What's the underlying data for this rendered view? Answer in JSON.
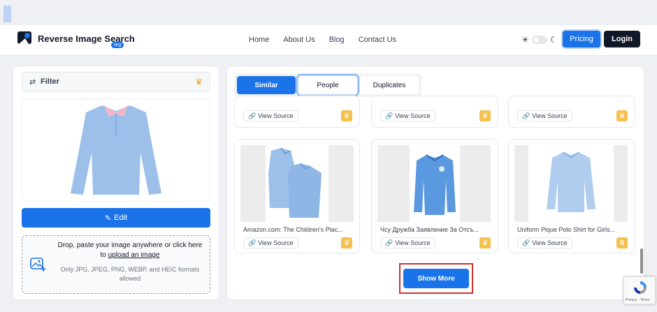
{
  "header": {
    "brand": "Reverse Image Search",
    "brand_badge": "org",
    "nav": [
      "Home",
      "About Us",
      "Blog",
      "Contact Us"
    ],
    "pricing": "Pricing",
    "login": "Login"
  },
  "sidebar": {
    "filter_label": "Filter",
    "edit_label": "Edit",
    "dropzone": {
      "line1": "Drop, paste your image anywhere or click here",
      "line2_prefix": "to ",
      "line2_link": "upload an image",
      "line3": "Only JPG, JPEG, PNG, WEBP, and HEIC formats allowed"
    }
  },
  "tabs": [
    {
      "label": "Similar",
      "state": "active"
    },
    {
      "label": "People",
      "state": "focused"
    },
    {
      "label": "Duplicates",
      "state": "normal"
    }
  ],
  "results_top": [
    {
      "source_label": "View Source"
    },
    {
      "source_label": "View Source"
    },
    {
      "source_label": "View Source"
    }
  ],
  "results": [
    {
      "title": "Amazon.com: The Children's Plac...",
      "source_label": "View Source"
    },
    {
      "title": "Чсу Дружба Заявление За Отсъ...",
      "source_label": "View Source"
    },
    {
      "title": "Uniform Pique Polo Shirt for Girls...",
      "source_label": "View Source"
    }
  ],
  "show_more": "Show More",
  "recaptcha": {
    "terms": "Privacy - Terms"
  },
  "colors": {
    "accent": "#1a73e8",
    "dark": "#111827",
    "crown": "#f5c04d",
    "highlight": "#d32f2f",
    "shirt": "#9cc0ea"
  }
}
